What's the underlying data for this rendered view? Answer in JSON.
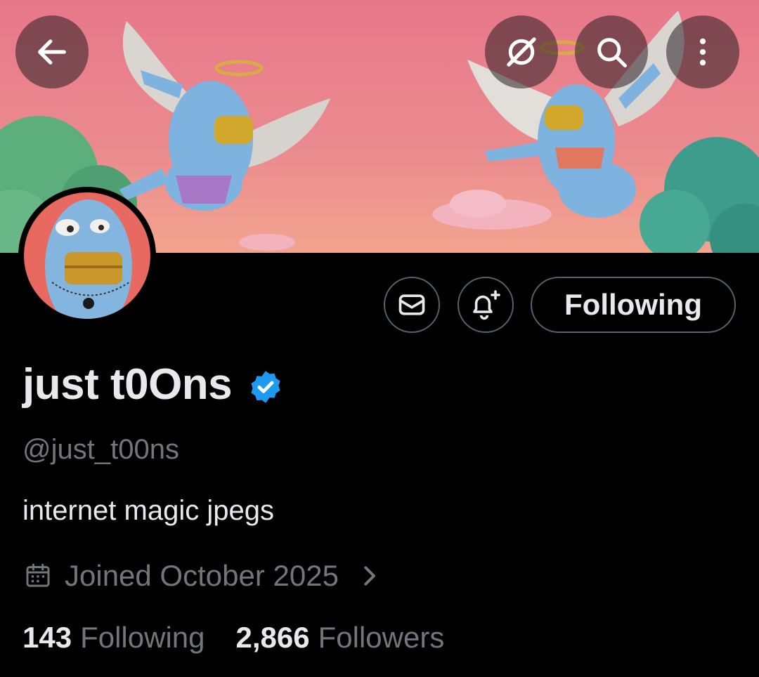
{
  "header": {
    "back_icon": "arrow-left-icon",
    "grok_icon": "grok-icon",
    "search_icon": "search-icon",
    "more_icon": "more-vertical-icon"
  },
  "profile": {
    "display_name": "just t0Ons",
    "verified": true,
    "handle": "@just_t00ns",
    "bio": "internet magic jpegs",
    "joined": "Joined October 2025",
    "following_count": "143",
    "following_label": "Following",
    "followers_count": "2,866",
    "followers_label": "Followers"
  },
  "actions": {
    "message_icon": "envelope-icon",
    "notify_icon": "bell-plus-icon",
    "follow_label": "Following"
  },
  "colors": {
    "background": "#000000",
    "text_primary": "#e7e9ea",
    "text_secondary": "#71767b",
    "border": "#536471",
    "verified_blue": "#1d9bf0",
    "banner_pink": "#e8818d"
  }
}
